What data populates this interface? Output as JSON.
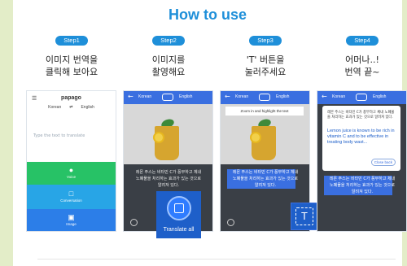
{
  "title": "How to use",
  "steps": [
    {
      "label": "Step1",
      "line1": "이미지 번역을",
      "line2": "클릭해 보아요"
    },
    {
      "label": "Step2",
      "line1": "이미지를",
      "line2": "촬영해요"
    },
    {
      "label": "Step3",
      "line1": "'T' 버튼을",
      "line2": "눌러주세요"
    },
    {
      "label": "Step4",
      "line1": "어머나..!",
      "line2": "번역 끝~"
    }
  ],
  "app": {
    "logo": "papago",
    "source_lang": "Korean",
    "target_lang": "English",
    "input_placeholder": "Type the text to translate",
    "voice_label": "Voice",
    "conversation_label": "Conversation",
    "image_label": "Image"
  },
  "korean_text": "레몬 주스는 비타민 C가 풍부하고 체내 노폐물을 처리하는 효과가 있는 것으로 알려져 있다.",
  "translate_all_label": "Translate all",
  "zoom_tip": "Zoom in and highlight the text",
  "t_button_label": "T",
  "translation": "Lemon juice is known to be rich in vitamin C and to be effective in treating body wast...",
  "close_label": "Close back"
}
